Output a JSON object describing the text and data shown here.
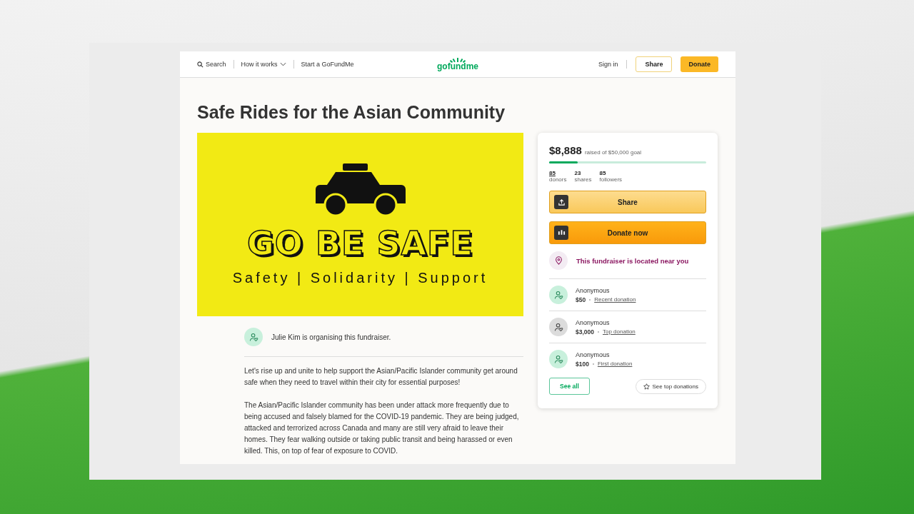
{
  "nav": {
    "links": [
      {
        "label": "Search",
        "kind": "search"
      },
      {
        "label": "How it works",
        "kind": "dropdown"
      },
      {
        "label": "Start a GoFundMe",
        "kind": "plain"
      }
    ],
    "logo": "gofundme",
    "sign_in": "Sign in",
    "share": "Share",
    "donate": "Donate"
  },
  "title": "Safe Rides for the Asian Community",
  "banner": {
    "headline": "GO BE SAFE",
    "tagline": "Safety | Solidarity | Support"
  },
  "organiser": "Julie Kim is organising this fundraiser.",
  "story": [
    "Let's rise up and unite to help support the Asian/Pacific Islander community get around safe when they need to travel within their city for essential purposes!",
    "The Asian/Pacific Islander community has been under attack more frequently due to being accused and falsely blamed for the COVID-19 pandemic. They are being judged, attacked and terrorized across Canada and many are still very afraid to leave their homes. They fear walking outside or taking public transit and being harassed or even killed. This, on top of fear of exposure to COVID."
  ],
  "card": {
    "raised": "$8,888",
    "goal": "raised of $50,000 goal",
    "level": 0.18,
    "stats": [
      {
        "value": "85",
        "label": "donors",
        "kind": "link"
      },
      {
        "value": "23",
        "label": "shares",
        "kind": "plain"
      },
      {
        "value": "85",
        "label": "followers",
        "kind": "plain"
      }
    ],
    "share": "Share",
    "donate_now": "Donate now",
    "location": "This fundraiser is located near you",
    "donations": [
      {
        "name": "Anonymous",
        "amount": "$50",
        "tag": "Recent donation",
        "color": "#c8f0dc"
      },
      {
        "name": "Anonymous",
        "amount": "$3,000",
        "tag": "Top donation",
        "color": "#dcdcdc"
      },
      {
        "name": "Anonymous",
        "amount": "$100",
        "tag": "First donation",
        "color": "#c8f0dc"
      }
    ],
    "see_all": "See all",
    "see_top": "See top donations"
  }
}
